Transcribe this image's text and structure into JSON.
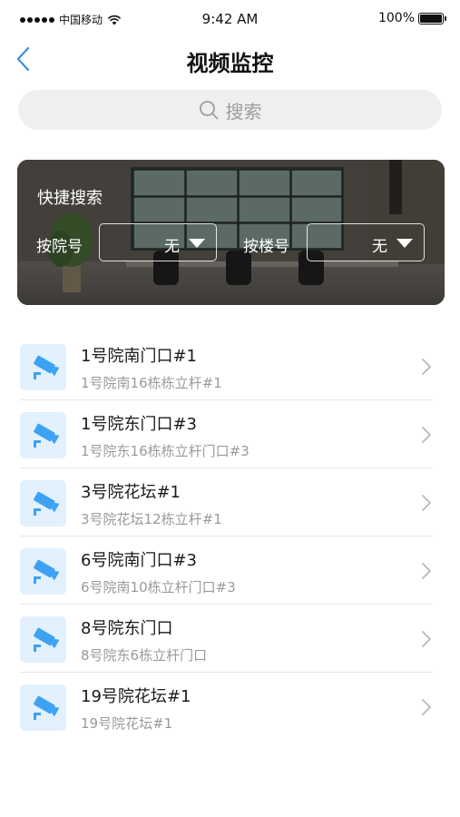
{
  "status_bar": {
    "carrier": "中国移动",
    "time": "9:42 AM",
    "battery_text": "100%",
    "battery_level": 1.0
  },
  "nav": {
    "title": "视频监控",
    "back_icon": "chevron-left-icon"
  },
  "search": {
    "placeholder": "搜索",
    "icon": "search-icon"
  },
  "quick_search": {
    "title": "快捷搜索",
    "courtyard_label": "按院号",
    "courtyard_value": "无",
    "building_label": "按楼号",
    "building_value": "无"
  },
  "cameras": [
    {
      "title": "1号院南门口#1",
      "subtitle": "1号院南16栋栋立杆#1"
    },
    {
      "title": "1号院东门口#3",
      "subtitle": "1号院东16栋栋立杆门口#3"
    },
    {
      "title": "3号院花坛#1",
      "subtitle": "3号院花坛12栋立杆#1"
    },
    {
      "title": "6号院南门口#3",
      "subtitle": "6号院南10栋立杆门口#3"
    },
    {
      "title": "8号院东门口",
      "subtitle": "8号院东6栋立杆门口"
    },
    {
      "title": "19号院花坛#1",
      "subtitle": "19号院花坛#1"
    }
  ],
  "colors": {
    "accent": "#3da2f4",
    "icon_bg": "#e3f0fd",
    "search_bg": "#efefef"
  }
}
